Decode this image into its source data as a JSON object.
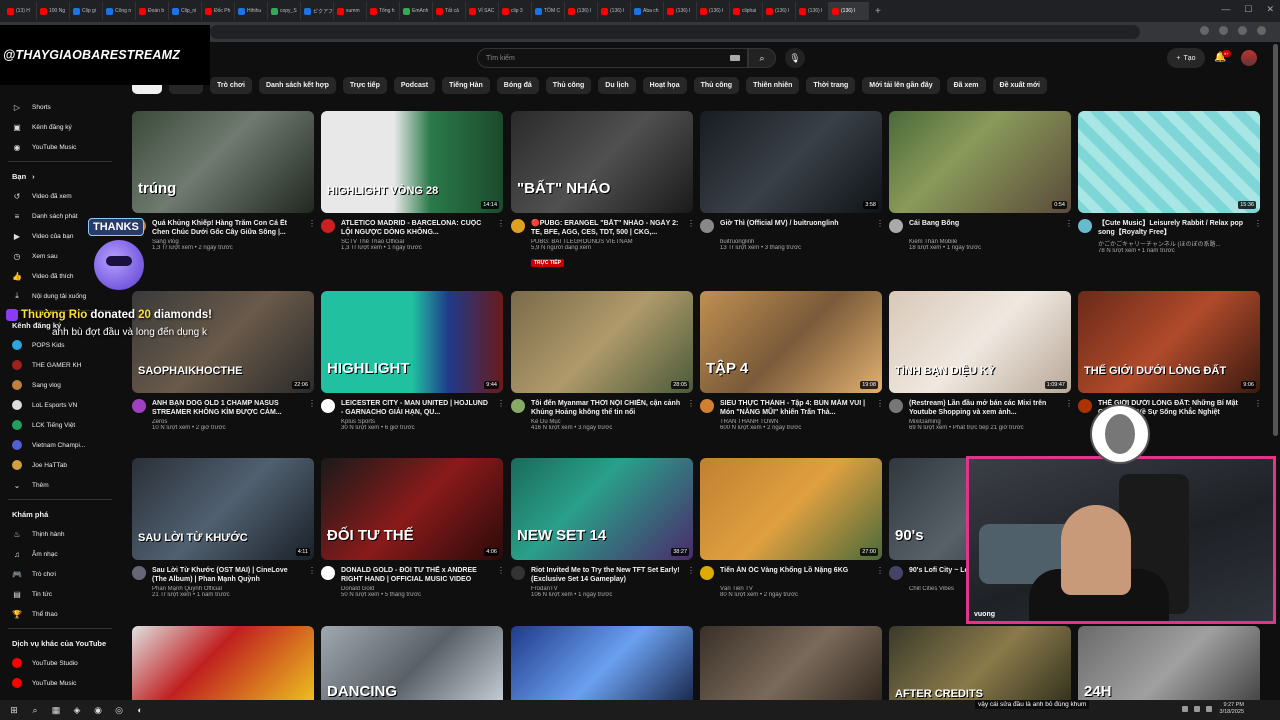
{
  "browser": {
    "tabs": [
      {
        "label": "(13) H",
        "color": "#ff0000"
      },
      {
        "label": "100 Ng",
        "color": "#ff0000"
      },
      {
        "label": "Clip gi",
        "color": "#1a73e8"
      },
      {
        "label": "Công n",
        "color": "#1a73e8"
      },
      {
        "label": "Đoán b",
        "color": "#ff0000"
      },
      {
        "label": "Clip_ni",
        "color": "#1a73e8"
      },
      {
        "label": "Đốc Ph",
        "color": "#ff0000"
      },
      {
        "label": "Hihihu",
        "color": "#1a73e8"
      },
      {
        "label": "copy_S",
        "color": "#34a853"
      },
      {
        "label": "ピクアフ",
        "color": "#1a73e8"
      },
      {
        "label": "summ",
        "color": "#ff0000"
      },
      {
        "label": "Tổng h",
        "color": "#ff0000"
      },
      {
        "label": "EmAnh",
        "color": "#34a853"
      },
      {
        "label": "Tất cả",
        "color": "#ff0000"
      },
      {
        "label": "VÍ SAC",
        "color": "#ff0000"
      },
      {
        "label": "clip 3",
        "color": "#ff0000"
      },
      {
        "label": "TÔM C",
        "color": "#1a73e8"
      },
      {
        "label": "(136) I",
        "color": "#ff0000"
      },
      {
        "label": "(136) I",
        "color": "#ff0000"
      },
      {
        "label": "Aba ch",
        "color": "#1a73e8"
      },
      {
        "label": "(136) I",
        "color": "#ff0000"
      },
      {
        "label": "(136) I",
        "color": "#ff0000"
      },
      {
        "label": "cliphai",
        "color": "#ff0000"
      },
      {
        "label": "(136) I",
        "color": "#ff0000"
      },
      {
        "label": "(136) I",
        "color": "#ff0000"
      },
      {
        "label": "(136) I",
        "color": "#ff0000"
      }
    ],
    "new_tab": "+",
    "window_controls": [
      "—",
      "☐",
      "✕"
    ]
  },
  "streamer_name": "@THAYGIAOBARESTREAMZ",
  "header": {
    "search_placeholder": "Tìm kiếm",
    "search_icon": "⌕",
    "mic_icon": "🎙",
    "create_label": "Tạo",
    "bell_icon": "🔔",
    "bell_badge": "9+"
  },
  "chips": [
    {
      "label": ""
    },
    {
      "label": ""
    },
    {
      "label": "Trò chơi"
    },
    {
      "label": "Danh sách kết hợp"
    },
    {
      "label": "Trực tiếp"
    },
    {
      "label": "Podcast"
    },
    {
      "label": "Tiếng Hàn"
    },
    {
      "label": "Bóng đá"
    },
    {
      "label": "Thủ công"
    },
    {
      "label": "Du lịch"
    },
    {
      "label": "Hoạt họa"
    },
    {
      "label": "Thủ công"
    },
    {
      "label": "Thiên nhiên"
    },
    {
      "label": "Thời trang"
    },
    {
      "label": "Mới tải lên gần đây"
    },
    {
      "label": "Đã xem"
    },
    {
      "label": "Đề xuất mới"
    }
  ],
  "sidebar": {
    "top": [
      {
        "label": "Shorts",
        "icon": "▷"
      },
      {
        "label": "Kênh đăng ký",
        "icon": "▣"
      },
      {
        "label": "YouTube Music",
        "icon": "◉"
      }
    ],
    "you_heading": "Bạn",
    "you_chevron": "›",
    "you": [
      {
        "label": "Video đã xem",
        "icon": "↺"
      },
      {
        "label": "Danh sách phát",
        "icon": "≡"
      },
      {
        "label": "Video của bạn",
        "icon": "▶"
      },
      {
        "label": "Xem sau",
        "icon": "◷"
      },
      {
        "label": "Video đã thích",
        "icon": "👍"
      },
      {
        "label": "Nội dung tải xuống",
        "icon": "⤓"
      }
    ],
    "subs_heading": "Kênh đăng ký",
    "subs": [
      {
        "label": "POPS Kids",
        "color": "#2ca6e0"
      },
      {
        "label": "THE GAMER KH",
        "color": "#a02020"
      },
      {
        "label": "Sang vlog",
        "color": "#c08040"
      },
      {
        "label": "LoL Esports VN",
        "color": "#dddddd"
      },
      {
        "label": "LCK Tiếng Việt",
        "color": "#20a060"
      },
      {
        "label": "Vietnam Champi...",
        "color": "#5060d0"
      },
      {
        "label": "Joe HaTTab",
        "color": "#d0a040"
      }
    ],
    "more_label": "Thêm",
    "more_icon": "⌄",
    "explore_heading": "Khám phá",
    "explore": [
      {
        "label": "Thịnh hành",
        "icon": "♨"
      },
      {
        "label": "Âm nhạc",
        "icon": "♫"
      },
      {
        "label": "Trò chơi",
        "icon": "🎮"
      },
      {
        "label": "Tin tức",
        "icon": "▤"
      },
      {
        "label": "Thể thao",
        "icon": "🏆"
      }
    ],
    "other_heading": "Dịch vụ khác của YouTube",
    "other": [
      {
        "label": "YouTube Studio",
        "color": "#ff0000"
      },
      {
        "label": "YouTube Music",
        "color": "#ff0000"
      }
    ]
  },
  "videos": [
    {
      "title": "Quá Khủng Khiếp! Hàng Trăm Con Cá Ết Chen Chúc Dưới Gốc Cây Giữa Sông |...",
      "channel": "Sang vlog",
      "stats": "1,3 Tr lượt xem • 2 ngày trước",
      "duration": "",
      "overlay": "trúng",
      "bg": "linear-gradient(135deg,#3a4a3a,#707a70 45%,#202820)",
      "av": "#c08040"
    },
    {
      "title": "ATLETICO MADRID - BARCELONA: CUỘC LỘI NGƯỢC DÒNG KHÔNG...",
      "channel": "SCTV Thể Thao Official",
      "stats": "1,3 Tr lượt xem • 1 ngày trước",
      "duration": "14:14",
      "overlay": "HIGHLIGHT VÒNG 28",
      "bg": "linear-gradient(90deg,#e8e8e8 40%,#2a7a4a 60%,#1c4a2c)",
      "av": "#cc2020"
    },
    {
      "title": "🔴PUBG: ERANGEL \"BẤT\" NHÁO - NGÀY 2: TE, BFE, AGG, CES, TDT, 500 | CKG,...",
      "channel": "PUBG: BATTLEGROUNDS VIETNAM",
      "stats": "5,9 N người đang xem",
      "duration": "",
      "live": "TRỰC TIẾP",
      "overlay": "\"BẤT\" NHÁO",
      "bg": "linear-gradient(135deg,#2a2a2a,#505050 50%,#1a1a1a)",
      "av": "#e0a020"
    },
    {
      "title": "Giờ Thì (Official MV) / buitruonglinh",
      "channel": "buitruonglinh",
      "stats": "13 Tr lượt xem • 3 tháng trước",
      "duration": "3:58",
      "overlay": "",
      "bg": "linear-gradient(135deg,#181c22,#3a4048 50%,#101418)",
      "av": "#888"
    },
    {
      "title": "Cái Bang Bống",
      "channel": "Kiếm Thần Mobile",
      "stats": "18 lượt xem • 1 ngày trước",
      "duration": "0:54",
      "overlay": "",
      "bg": "linear-gradient(135deg,#4a6a3a,#8a9a5a 40%,#5a4a3a)",
      "av": "#aaa"
    },
    {
      "title": "【Cute Music】Leisurely Rabbit / Relax pop song【Royalty Free】",
      "channel": "かごかごキャリーチャンネル (ほのぼの系路...",
      "stats": "78 N lượt xem • 1 năm trước",
      "duration": "15:36",
      "overlay": "",
      "bg": "repeating-linear-gradient(45deg,#7fd6d6 0 10px,#a8e6e6 10px 20px)",
      "av": "#6bc"
    },
    {
      "title": "ANH BẠN DOG OLD 1 CHAMP NASUS STREAMER KHÔNG KÌM ĐƯỢC CẢM...",
      "channel": "Zeros",
      "stats": "10 N lượt xem • 2 giờ trước",
      "duration": "22:06",
      "overlay": "SAOPHAIKHOCTHE",
      "bg": "linear-gradient(135deg,#3a3a3a,#6a5a4a 50%,#2a2a2a)",
      "av": "#a040c0"
    },
    {
      "title": "LEICESTER CITY - MAN UNITED | HOJLUND - GARNACHO GIẢI HẠN, QU...",
      "channel": "Kplus Sports",
      "stats": "30 N lượt xem • 6 giờ trước",
      "duration": "9:44",
      "overlay": "HIGHLIGHT",
      "bg": "linear-gradient(90deg,#20c0a0 50%,#203a8a 70%,#6a1a1a)",
      "av": "#fff"
    },
    {
      "title": "Tôi đến Myanmar THỜI NỘI CHIẾN, cận cảnh Khủng Hoảng không thể tin nổi",
      "channel": "Kê Du Mục",
      "stats": "416 N lượt xem • 3 ngày trước",
      "duration": "28:05",
      "overlay": "",
      "bg": "linear-gradient(135deg,#7a6a4a,#b09a6a 50%,#4a5a3a)",
      "av": "#8a6"
    },
    {
      "title": "SIEU THỰC THÀNH - Tập 4: BÚN MẮM VUI | Món \"NĂNG MŨI\" khiến Trấn Thà...",
      "channel": "TRẤN THÀNH TOWN",
      "stats": "600 N lượt xem • 2 ngày trước",
      "duration": "19:08",
      "overlay": "TẬP 4",
      "bg": "linear-gradient(135deg,#c09050,#7a5a3a 50%,#e0b070)",
      "av": "#d08030"
    },
    {
      "title": "(Restream) Lần đầu mở bán các Mixi trên Youtube Shopping và xem ảnh...",
      "channel": "MixiGaming",
      "stats": "69 N lượt xem • Phát trực tiếp 21 giờ trước",
      "duration": "1:09:47",
      "overlay": "TÌNH BẠN DIỆU KỲ",
      "bg": "linear-gradient(135deg,#d8c8b8,#f0e8e0 50%,#b8a898)",
      "av": "#777"
    },
    {
      "title": "THẾ GIỚI DƯỚI LÒNG ĐẤT: Những Bí Mật Chấn Động Về Sự Sống Khắc Nghiệt",
      "channel": "",
      "stats": "",
      "duration": "9:06",
      "overlay": "THẾ GIỚI DƯỚI LÒNG ĐẤT",
      "bg": "linear-gradient(135deg,#6a2a1a,#b04a2a 50%,#3a1a10)",
      "av": "#a30"
    },
    {
      "title": "Sau Lời Từ Khước (OST MAI) | CineLove (The Album) | Phan Mạnh Quỳnh",
      "channel": "Phan Mạnh Quỳnh Official",
      "stats": "21 Tr lượt xem • 1 năm trước",
      "duration": "4:11",
      "overlay": "SAU LỜI TỪ KHƯỚC",
      "bg": "linear-gradient(135deg,#2a3038,#506070 50%,#1a2028)",
      "av": "#667"
    },
    {
      "title": "DONALD GOLD - ĐỐI TƯ THẾ x ANDREE RIGHT HAND | OFFICIAL MUSIC VIDEO",
      "channel": "Donald Gold",
      "stats": "50 N lượt xem • 5 tháng trước",
      "duration": "4:06",
      "overlay": "ĐỐI TƯ THẾ",
      "bg": "linear-gradient(135deg,#1a1a1a,#8a1a1a 50%,#2a0a0a)",
      "av": "#fff"
    },
    {
      "title": "Riot Invited Me to Try the New TFT Set Early! (Exclusive Set 14 Gameplay)",
      "channel": "FrodanTV",
      "stats": "106 N lượt xem • 1 ngày trước",
      "duration": "38:27",
      "overlay": "NEW SET 14",
      "bg": "linear-gradient(135deg,#1a6a5a,#2aa08a 40%,#4a2a6a)",
      "av": "#333"
    },
    {
      "title": "Tiến ĂN ỐC Vàng Khổng Lồ Nặng 6KG",
      "channel": "Văn Tiến TV",
      "stats": "80 N lượt xem • 2 ngày trước",
      "duration": "27:00",
      "overlay": "",
      "bg": "linear-gradient(135deg,#c08030,#e0a040 50%,#4a6a3a)",
      "av": "#da0"
    },
    {
      "title": "90's Lofi City ~ Lofi Music & R...",
      "channel": "Chill Cities Vibes",
      "stats": "",
      "duration": "",
      "overlay": "90's",
      "bg": "linear-gradient(135deg,#30383e,#586068 50%,#20282e)",
      "av": "#446"
    },
    {
      "title": "",
      "channel": "",
      "stats": "",
      "duration": "",
      "overlay": "",
      "bg": "",
      "av": ""
    },
    {
      "title": "",
      "channel": "",
      "stats": "",
      "duration": "",
      "overlay": "",
      "bg": "linear-gradient(135deg,#e0e0e0,#c02020 40%,#f0d020)",
      "av": ""
    },
    {
      "title": "",
      "channel": "",
      "stats": "",
      "duration": "",
      "overlay": "DANCING",
      "bg": "linear-gradient(135deg,#a0a8b0,#5a6068 50%,#d0d8e0)",
      "av": ""
    },
    {
      "title": "",
      "channel": "",
      "stats": "",
      "duration": "",
      "overlay": "",
      "bg": "linear-gradient(135deg,#203a8a,#6aa0f0 50%,#101a3a)",
      "av": ""
    },
    {
      "title": "",
      "channel": "",
      "stats": "",
      "duration": "",
      "overlay": "",
      "bg": "linear-gradient(135deg,#3a3028,#7a6a5a 50%,#2a2018)",
      "av": ""
    },
    {
      "title": "",
      "channel": "",
      "stats": "",
      "duration": "",
      "overlay": "AFTER CREDITS",
      "bg": "linear-gradient(135deg,#3a3a2a,#8a7a4a 50%,#2a2a1a)",
      "av": ""
    },
    {
      "title": "",
      "channel": "",
      "stats": "",
      "duration": "",
      "overlay": "24H",
      "bg": "linear-gradient(135deg,#6a6a6a,#a0a0a0 50%,#3a3a3a)",
      "av": ""
    }
  ],
  "overlay": {
    "thanks": "THANKS",
    "donor": "Thường Rio",
    "donated_word": "donated",
    "amount": "20",
    "unit": "diamonds!",
    "message": "anh bù đợt đầu và long đến dụng k",
    "caption": "vậy cái sửa đầu là anh bỏ đúng khum",
    "cam_label": "vuong"
  },
  "taskbar": {
    "icons": [
      "⊞",
      "⌕",
      "▦",
      "◈",
      "◉",
      "◎",
      "◐"
    ],
    "time": "9:27 PM",
    "date": "3/18/2025"
  }
}
